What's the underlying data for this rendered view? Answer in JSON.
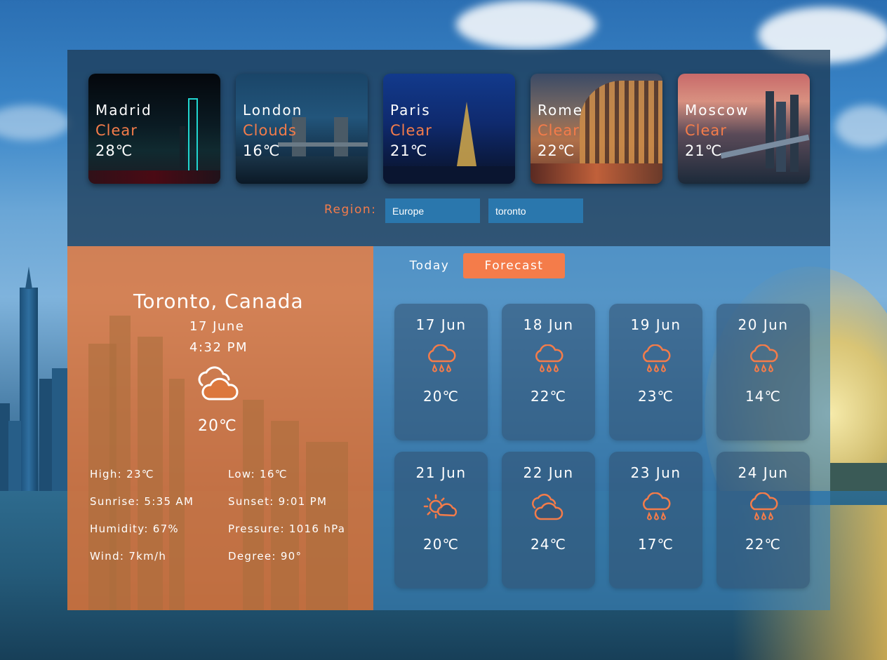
{
  "cities": [
    {
      "name": "Madrid",
      "condition": "Clear",
      "temp": "28℃"
    },
    {
      "name": "London",
      "condition": "Clouds",
      "temp": "16℃"
    },
    {
      "name": "Paris",
      "condition": "Clear",
      "temp": "21℃"
    },
    {
      "name": "Rome",
      "condition": "Clear",
      "temp": "22℃"
    },
    {
      "name": "Moscow",
      "condition": "Clear",
      "temp": "21℃"
    }
  ],
  "region": {
    "label": "Region:",
    "region_value": "Europe",
    "city_value": "toronto"
  },
  "current": {
    "location": "Toronto, Canada",
    "date": "17 June",
    "time": "4:32 PM",
    "icon": "clouds-icon",
    "temp": "20℃",
    "stats": {
      "high": "High: 23℃",
      "low": "Low: 16℃",
      "sunrise": "Sunrise: 5:35 AM",
      "sunset": "Sunset: 9:01 PM",
      "humidity": "Humidity: 67%",
      "pressure": "Pressure: 1016 hPa",
      "wind": "Wind: 7km/h",
      "degree": "Degree: 90°"
    }
  },
  "tabs": {
    "today": "Today",
    "forecast": "Forecast",
    "active": "forecast"
  },
  "forecast": [
    {
      "date": "17 Jun",
      "icon": "rain-icon",
      "temp": "20℃"
    },
    {
      "date": "18 Jun",
      "icon": "rain-icon",
      "temp": "22℃"
    },
    {
      "date": "19 Jun",
      "icon": "rain-icon",
      "temp": "23℃"
    },
    {
      "date": "20 Jun",
      "icon": "rain-icon",
      "temp": "14℃"
    },
    {
      "date": "21 Jun",
      "icon": "partly-sunny-icon",
      "temp": "20℃"
    },
    {
      "date": "22 Jun",
      "icon": "clouds-icon",
      "temp": "24℃"
    },
    {
      "date": "23 Jun",
      "icon": "rain-icon",
      "temp": "17℃"
    },
    {
      "date": "24 Jun",
      "icon": "rain-icon",
      "temp": "22℃"
    }
  ],
  "colors": {
    "accent": "#f47c4a",
    "field": "#2a77ad"
  }
}
